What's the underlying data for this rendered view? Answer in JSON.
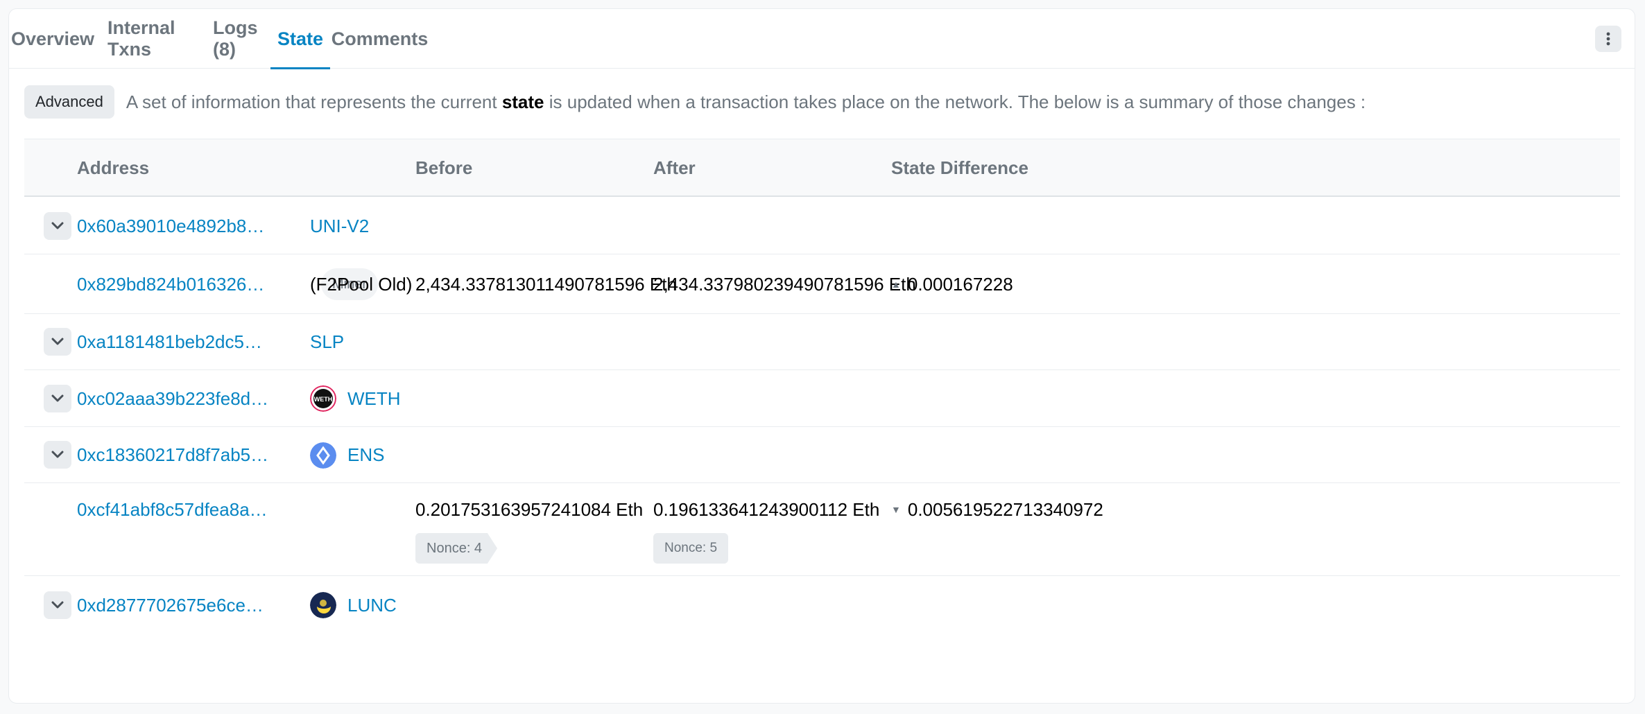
{
  "tabs": [
    {
      "label": "Overview"
    },
    {
      "label": "Internal Txns"
    },
    {
      "label": "Logs (8)"
    },
    {
      "label": "State"
    },
    {
      "label": "Comments"
    }
  ],
  "intro": {
    "badge": "Advanced",
    "text_before": "A set of information that represents the current ",
    "text_bold": "state",
    "text_after": " is updated when a transaction takes place on the network. The below is a summary of those changes :"
  },
  "table": {
    "headers": {
      "address": "Address",
      "before": "Before",
      "after": "After",
      "diff": "State Difference"
    },
    "rows": [
      {
        "address": "0x60a39010e4892b8…",
        "label": "UNI-V2"
      },
      {
        "address": "0x829bd824b016326…",
        "badge": "Miner",
        "label": "(F2Pool Old)",
        "before": "2,434.337813011490781596 Eth",
        "after": "2,434.337980239490781596 Eth",
        "diff": "0.000167228",
        "diff_direction": "up"
      },
      {
        "address": "0xa1181481beb2dc5…",
        "label": "SLP"
      },
      {
        "address": "0xc02aaa39b223fe8d…",
        "label": "WETH",
        "logo": "weth-logo",
        "logo_text": "WETH"
      },
      {
        "address": "0xc18360217d8f7ab5…",
        "label": "ENS",
        "logo": "ens-logo"
      },
      {
        "address": "0xcf41abf8c57dfea8a…",
        "before": "0.201753163957241084 Eth",
        "after": "0.196133641243900112 Eth",
        "diff": "0.005619522713340972",
        "diff_direction": "down",
        "nonce_before": "Nonce: 4",
        "nonce_after": "Nonce: 5"
      },
      {
        "address": "0xd2877702675e6ce…",
        "label": "LUNC",
        "logo": "lunc-logo"
      }
    ]
  },
  "colors": {
    "link": "#0784c3",
    "muted": "#6c757d",
    "header_bg": "#f8f9fa",
    "badge_bg": "#e9ecef"
  }
}
